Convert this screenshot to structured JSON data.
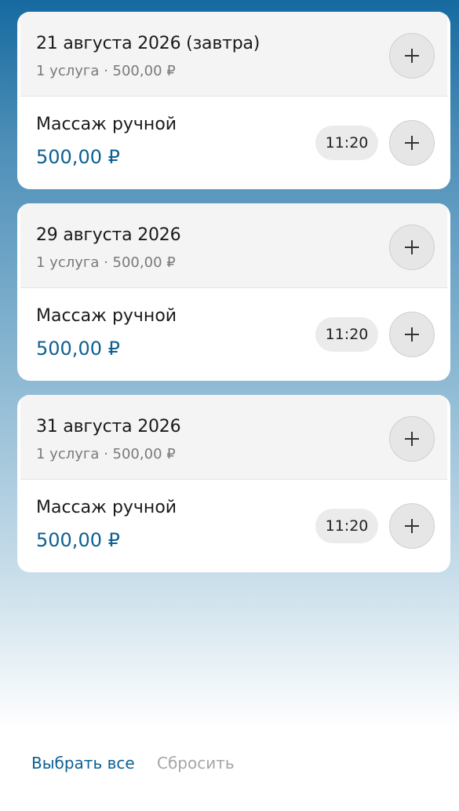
{
  "days": [
    {
      "date": "21 августа 2026 (завтра)",
      "summary": "1 услуга · 500,00 ₽",
      "service": {
        "name": "Массаж ручной",
        "price": "500,00 ₽",
        "time": "11:20"
      }
    },
    {
      "date": "29 августа 2026",
      "summary": "1 услуга · 500,00 ₽",
      "service": {
        "name": "Массаж ручной",
        "price": "500,00 ₽",
        "time": "11:20"
      }
    },
    {
      "date": "31 августа 2026",
      "summary": "1 услуга · 500,00 ₽",
      "service": {
        "name": "Массаж ручной",
        "price": "500,00 ₽",
        "time": "11:20"
      }
    }
  ],
  "actions": {
    "select_all": "Выбрать все",
    "reset": "Сбросить"
  },
  "colors": {
    "accent": "#0d6092",
    "muted": "#a6a6a6"
  },
  "icons": {
    "add": "plus-icon"
  }
}
